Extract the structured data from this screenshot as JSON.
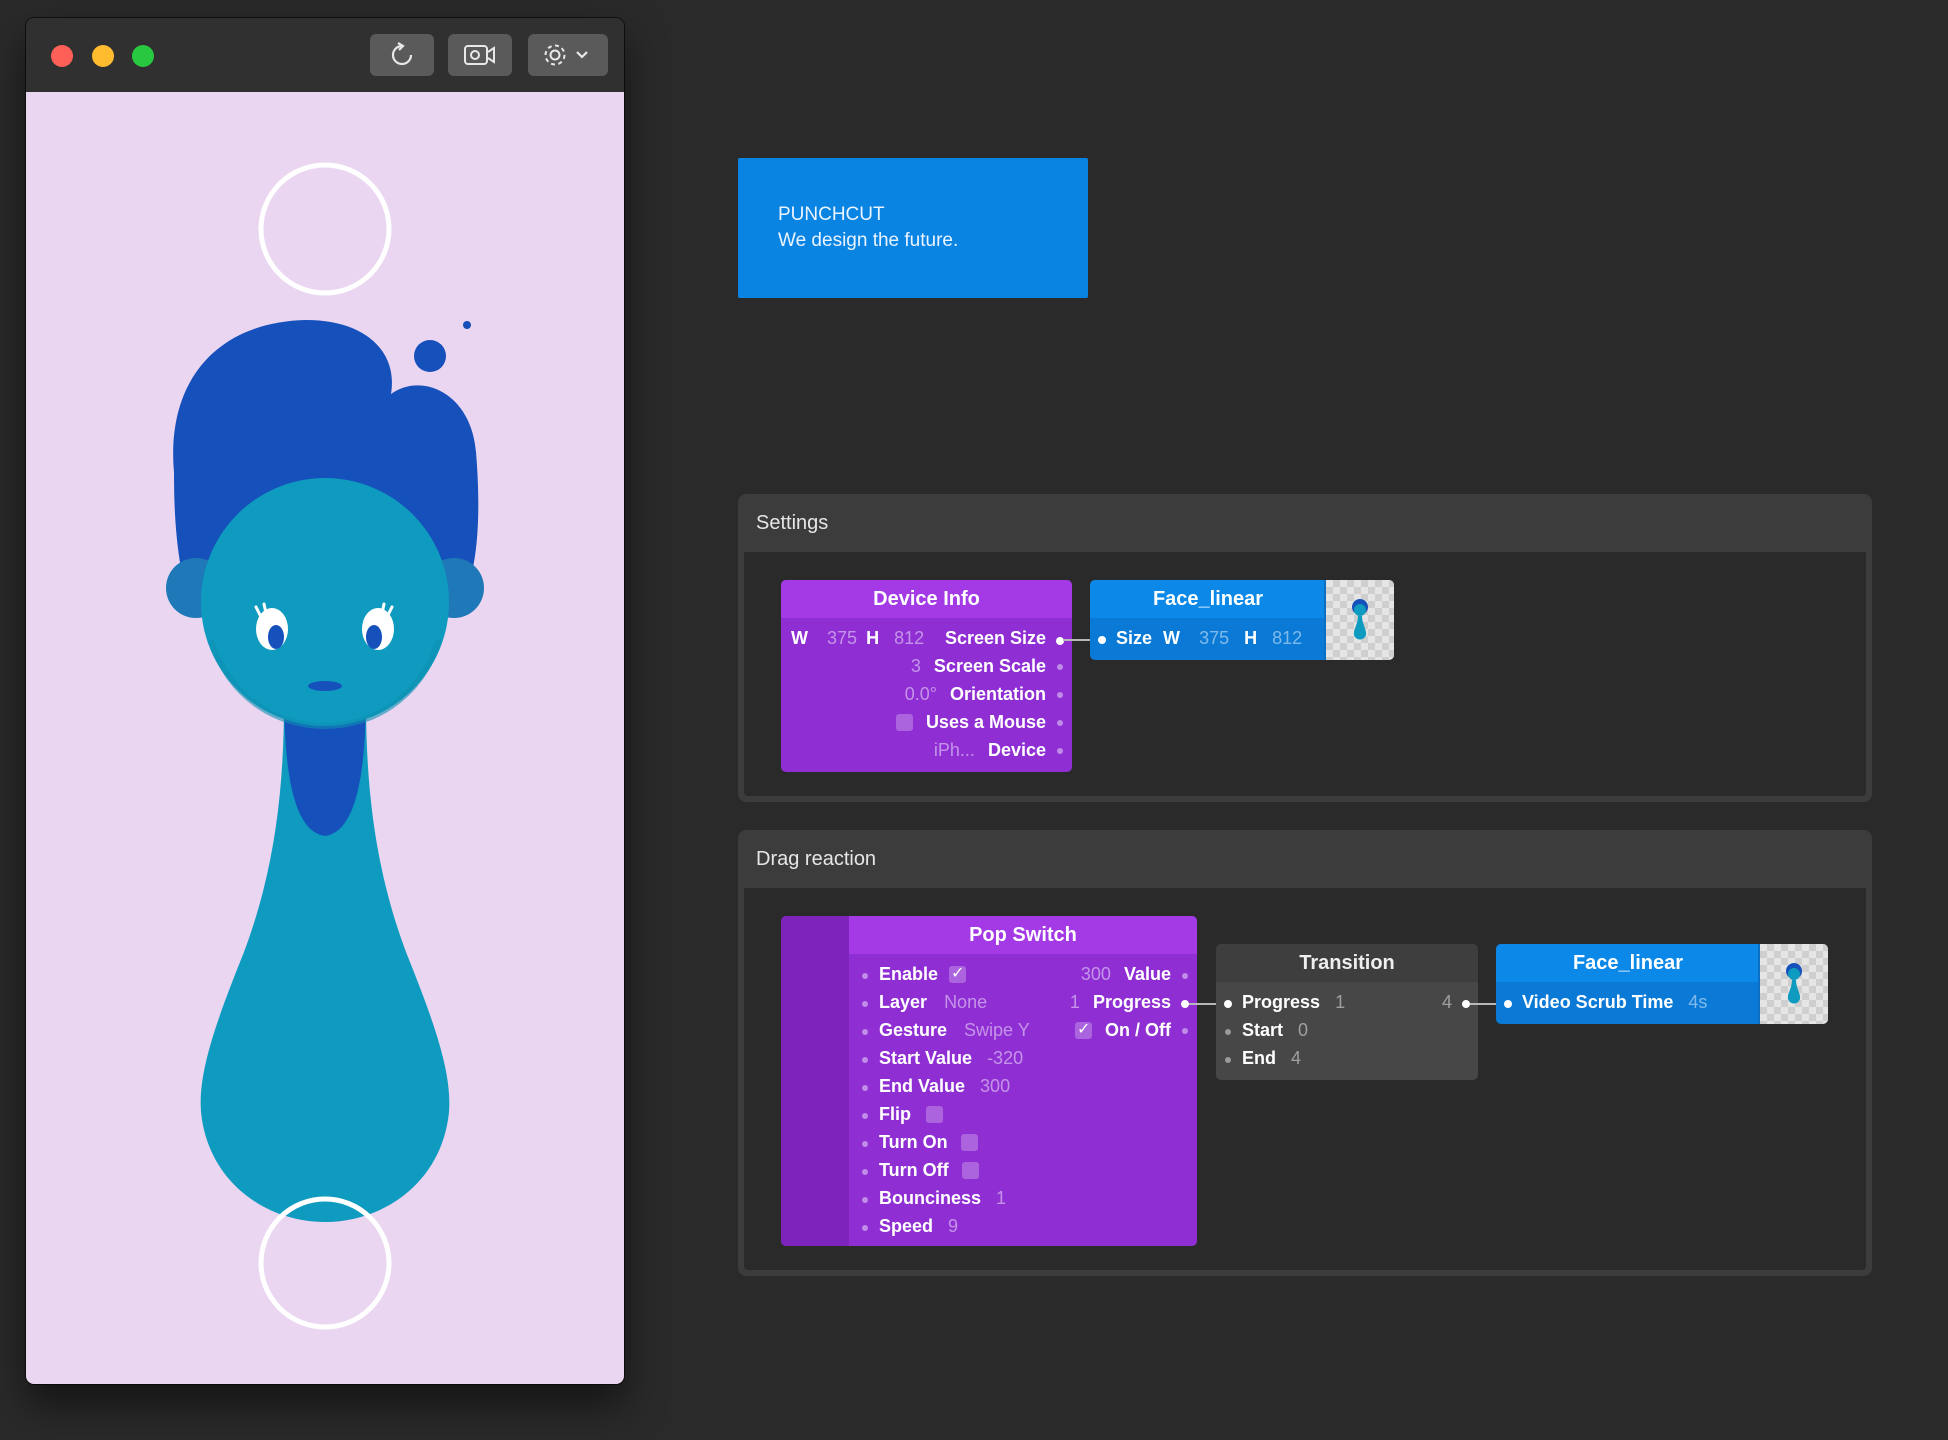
{
  "viewer": {
    "toolbar": {
      "refresh_icon": "refresh-icon",
      "record_icon": "video-record-icon",
      "settings_icon": "gear-icon"
    },
    "colors": {
      "canvas_bg": "#ead6f1",
      "hair": "#1650bb",
      "face": "#0e9bbf"
    }
  },
  "comment": {
    "line1": "PUNCHCUT",
    "line2": "We design the future."
  },
  "settings_group": {
    "title": "Settings",
    "device_info": {
      "title": "Device Info",
      "w_label": "W",
      "w_value": "375",
      "h_label": "H",
      "h_value": "812",
      "screen_size": "Screen Size",
      "screen_scale_value": "3",
      "screen_scale": "Screen Scale",
      "orientation_value": "0.0°",
      "orientation": "Orientation",
      "uses_mouse": "Uses a Mouse",
      "device_value": "iPh...",
      "device": "Device"
    },
    "face_linear": {
      "title": "Face_linear",
      "size": "Size",
      "w_label": "W",
      "w_value": "375",
      "h_label": "H",
      "h_value": "812"
    }
  },
  "drag_group": {
    "title": "Drag reaction",
    "pop_switch": {
      "title": "Pop Switch",
      "enable": "Enable",
      "layer": "Layer",
      "layer_value": "None",
      "gesture": "Gesture",
      "gesture_value": "Swipe Y",
      "start_value": "Start Value",
      "start_value_value": "-320",
      "end_value": "End Value",
      "end_value_value": "300",
      "flip": "Flip",
      "turn_on": "Turn On",
      "turn_off": "Turn Off",
      "bounciness": "Bounciness",
      "bounciness_value": "1",
      "speed": "Speed",
      "speed_value": "9",
      "out_value_value": "300",
      "out_value": "Value",
      "out_progress_value": "1",
      "out_progress": "Progress",
      "out_onoff": "On / Off"
    },
    "transition": {
      "title": "Transition",
      "progress": "Progress",
      "progress_value": "1",
      "start": "Start",
      "start_value": "0",
      "end": "End",
      "end_value": "4",
      "out_value": "4"
    },
    "face_linear": {
      "title": "Face_linear",
      "video_scrub": "Video Scrub Time",
      "video_scrub_value": "4s"
    }
  }
}
